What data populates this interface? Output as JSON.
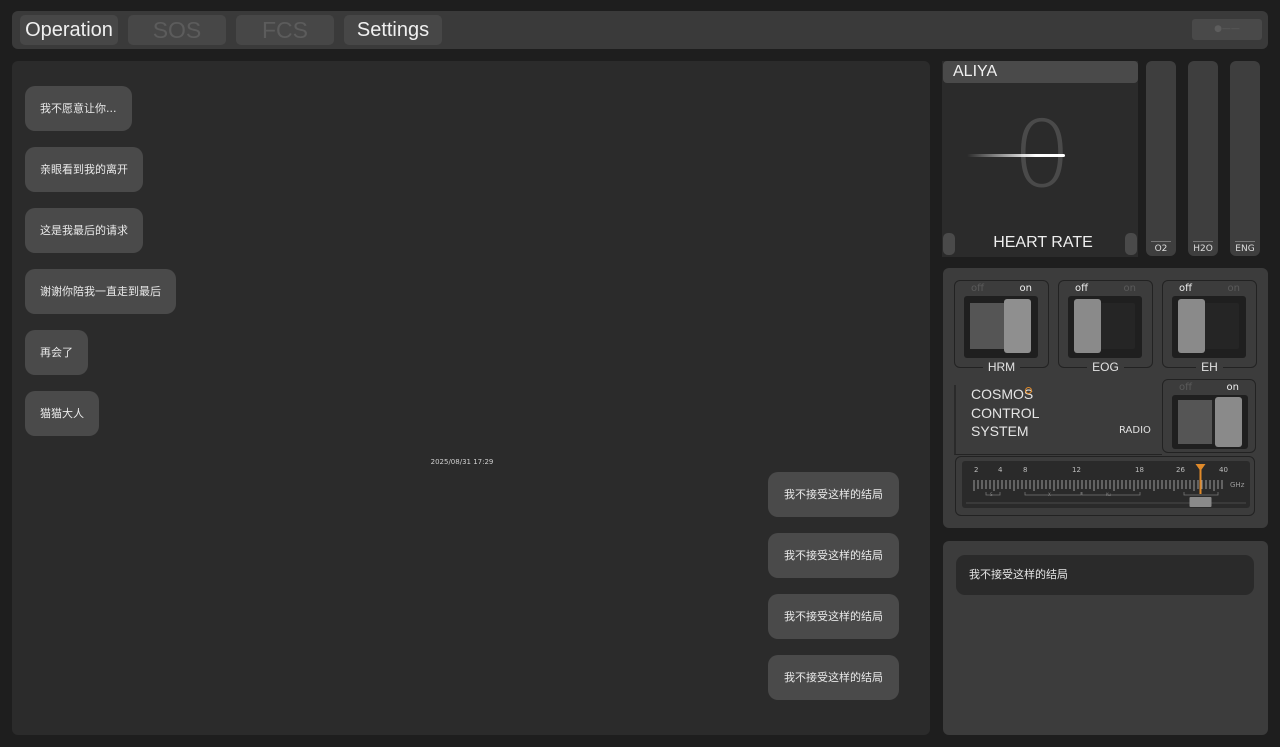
{
  "nav": {
    "tabs": [
      {
        "label": "Operation",
        "state": "active"
      },
      {
        "label": "SOS",
        "state": "dim"
      },
      {
        "label": "FCS",
        "state": "dim"
      },
      {
        "label": "Settings",
        "state": "active"
      }
    ]
  },
  "chat": {
    "incoming": [
      "我不愿意让你...",
      "亲眼看到我的离开",
      "这是我最后的请求",
      "谢谢你陪我一直走到最后",
      "再会了",
      "猫猫大人"
    ],
    "timestamp": "2025/08/31  17:29",
    "outgoing": [
      "我不接受这样的结局",
      "我不接受这样的结局",
      "我不接受这样的结局",
      "我不接受这样的结局"
    ]
  },
  "vital": {
    "name": "ALIYA",
    "heart_rate_value": "0",
    "heart_rate_label": "HEART RATE",
    "gauges": [
      {
        "label": "O2",
        "level": 0
      },
      {
        "label": "H2O",
        "level": 0
      },
      {
        "label": "ENG",
        "level": 0
      }
    ]
  },
  "controls": {
    "off_label": "off",
    "on_label": "on",
    "switches": [
      {
        "name": "HRM",
        "state": "on"
      },
      {
        "name": "EOG",
        "state": "off"
      },
      {
        "name": "EH",
        "state": "off"
      }
    ],
    "system_lines": [
      "COSMOS",
      "CONTROL",
      "SYSTEM"
    ],
    "radio_label": "RADIO",
    "radio_state": "on",
    "tuner": {
      "ticks": [
        "2",
        "4",
        "8",
        "12",
        "18",
        "26",
        "40"
      ],
      "unit": "GHz",
      "bands": [
        "S",
        "X",
        "Ku"
      ],
      "value_ghz": 33
    }
  },
  "side_panel": {
    "message": "我不接受这样的结局"
  },
  "colors": {
    "accent": "#e08a2a",
    "panel": "#3c3c3c",
    "bubble": "#4a4a4a"
  }
}
